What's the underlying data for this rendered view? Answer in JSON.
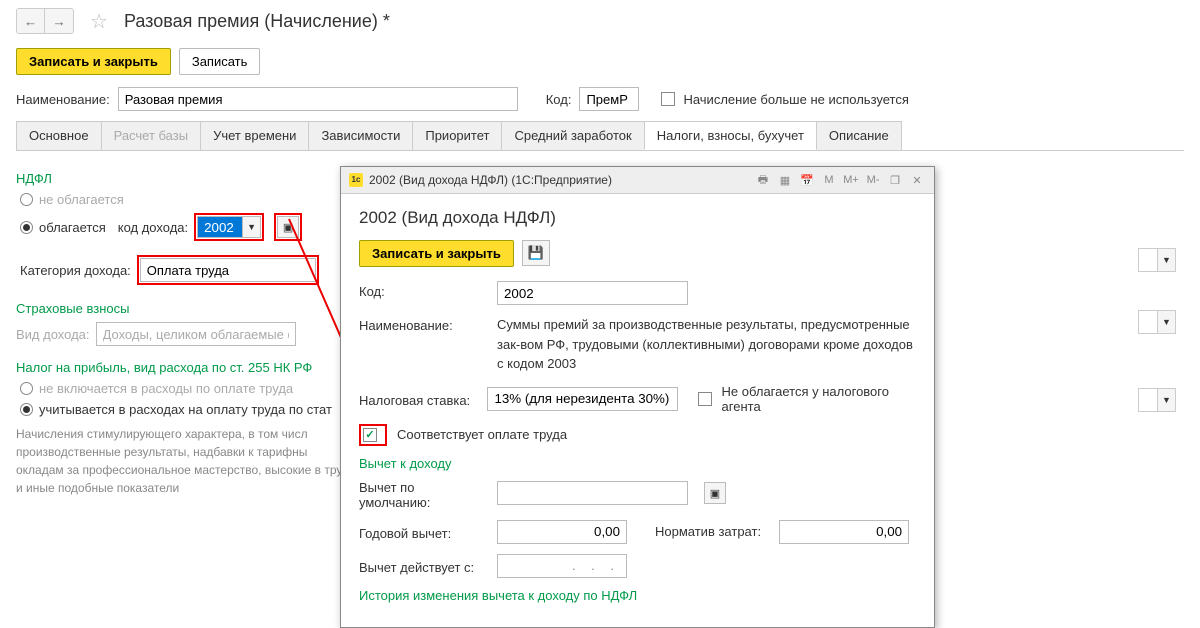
{
  "header": {
    "title": "Разовая премия (Начисление) *"
  },
  "toolbar": {
    "save_close": "Записать и закрыть",
    "save": "Записать"
  },
  "form": {
    "name_label": "Наименование:",
    "name_value": "Разовая премия",
    "code_label": "Код:",
    "code_value": "ПремР",
    "not_used_label": "Начисление больше не используется"
  },
  "tabs": [
    "Основное",
    "Расчет базы",
    "Учет времени",
    "Зависимости",
    "Приоритет",
    "Средний заработок",
    "Налоги, взносы, бухучет",
    "Описание"
  ],
  "ndfl": {
    "title": "НДФЛ",
    "not_taxed": "не облагается",
    "taxed": "облагается",
    "income_code_label": "код дохода:",
    "income_code": "2002",
    "category_label": "Категория дохода:",
    "category_value": "Оплата труда"
  },
  "insurance": {
    "title": "Страховые взносы",
    "income_type_label": "Вид дохода:",
    "income_type_value": "Доходы, целиком облагаемые ст"
  },
  "profit_tax": {
    "title": "Налог на прибыль, вид расхода по ст. 255 НК РФ",
    "not_included": "не включается в расходы по оплате труда",
    "included": "учитывается в расходах на оплату труда по стат"
  },
  "info": "Начисления стимулирующего характера, в том числ производственные результаты, надбавки к тарифны окладам за профессиональное мастерство, высокие в труде и иные подобные показатели",
  "modal": {
    "window_title": "2002 (Вид дохода НДФЛ)   (1С:Предприятие)",
    "heading": "2002 (Вид дохода НДФЛ)",
    "save_close": "Записать и закрыть",
    "code_label": "Код:",
    "code_value": "2002",
    "name_label": "Наименование:",
    "name_value": "Суммы премий за производственные результаты, предусмотренные зак-вом РФ, трудовыми (коллективными) договорами кроме доходов с кодом 2003",
    "rate_label": "Налоговая ставка:",
    "rate_value": "13% (для нерезидента 30%)",
    "not_taxed_agent": "Не облагается у налогового агента",
    "matches_salary": "Соответствует оплате труда",
    "deduction_title": "Вычет к доходу",
    "default_deduction": "Вычет по умолчанию:",
    "annual_deduction": "Годовой вычет:",
    "annual_value": "0,00",
    "norm_label": "Норматив затрат:",
    "norm_value": "0,00",
    "valid_from": "Вычет действует с:",
    "history_link": "История изменения вычета к доходу по НДФЛ",
    "m_buttons": [
      "M",
      "M+",
      "M-"
    ]
  }
}
